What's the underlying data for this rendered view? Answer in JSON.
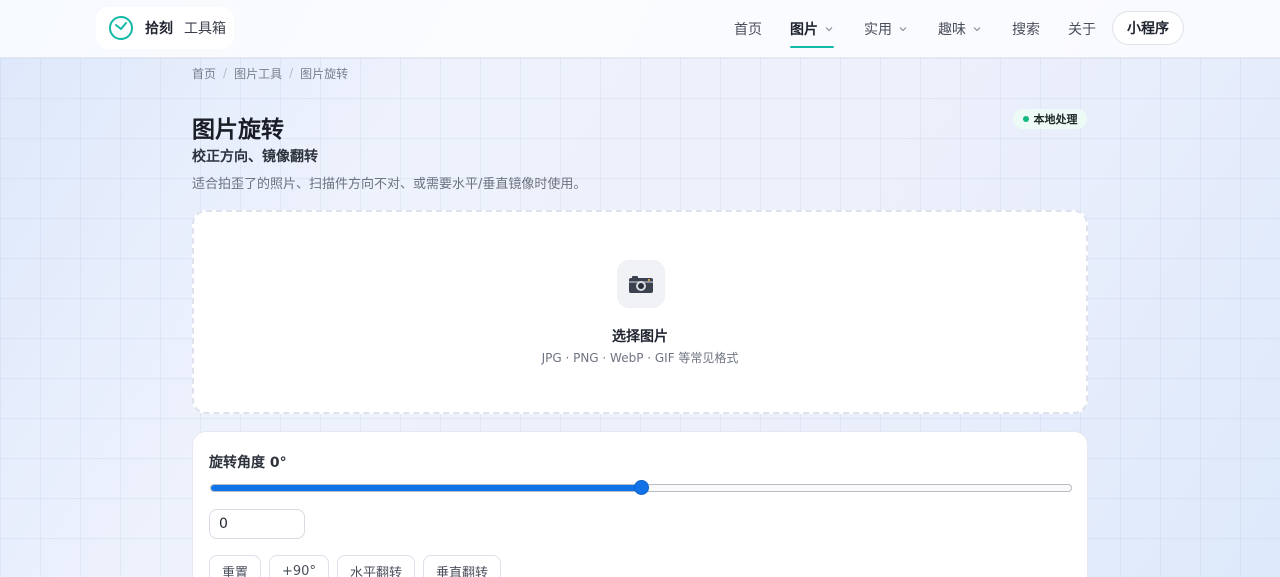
{
  "header": {
    "logo_name": "拾刻",
    "logo_sub": "工具箱",
    "nav": [
      {
        "label": "首页",
        "has_dropdown": false,
        "active": false
      },
      {
        "label": "图片",
        "has_dropdown": true,
        "active": true
      },
      {
        "label": "实用",
        "has_dropdown": true,
        "active": false
      },
      {
        "label": "趣味",
        "has_dropdown": true,
        "active": false
      },
      {
        "label": "搜索",
        "has_dropdown": false,
        "active": false
      },
      {
        "label": "关于",
        "has_dropdown": false,
        "active": false
      }
    ],
    "mini_program_label": "小程序"
  },
  "breadcrumb": [
    "首页",
    "图片工具",
    "图片旋转"
  ],
  "page": {
    "title": "图片旋转",
    "subtitle": "校正方向、镜像翻转",
    "description": "适合拍歪了的照片、扫描件方向不对、或需要水平/垂直镜像时使用。",
    "badge": "本地处理"
  },
  "upload": {
    "icon": "camera-icon",
    "title": "选择图片",
    "hint": "JPG · PNG · WebP · GIF 等常见格式"
  },
  "controls": {
    "angle_label": "旋转角度 0°",
    "slider_fraction": 0.5,
    "angle_value": "0",
    "buttons": [
      "重置",
      "+90°",
      "水平翻转",
      "垂直翻转"
    ]
  },
  "colors": {
    "accent_teal": "#14b8a6",
    "slider_blue": "#1273e8",
    "badge_green": "#10b981"
  }
}
